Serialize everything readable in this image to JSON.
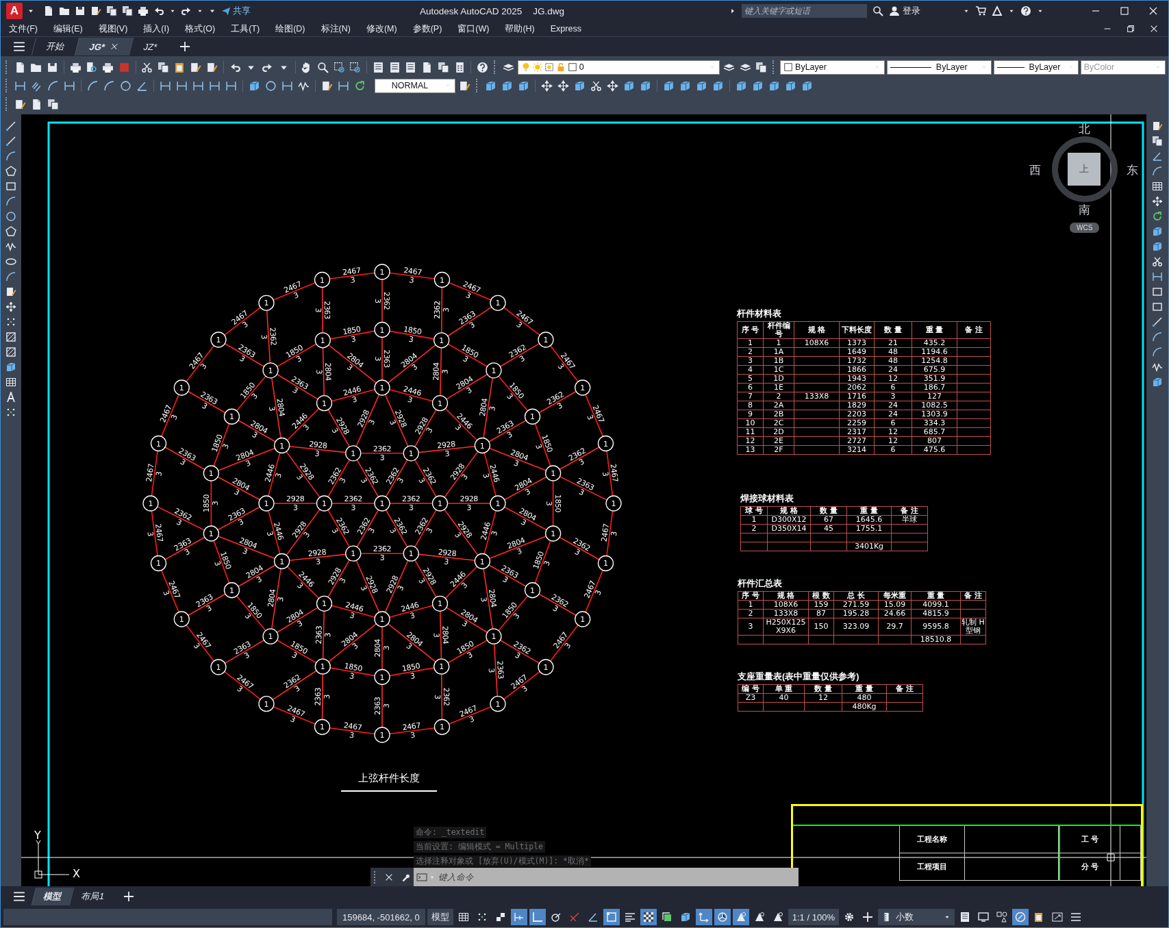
{
  "title_bar": {
    "logo": "A",
    "share": "共享",
    "app_name": "Autodesk AutoCAD 2025",
    "file_name": "JG.dwg",
    "search_placeholder": "键入关键字或短语",
    "user": "登录"
  },
  "menu": [
    "文件(F)",
    "编辑(E)",
    "视图(V)",
    "插入(I)",
    "格式(O)",
    "工具(T)",
    "绘图(D)",
    "标注(N)",
    "修改(M)",
    "参数(P)",
    "窗口(W)",
    "帮助(H)",
    "Express"
  ],
  "doc_tabs": [
    {
      "label": "开始",
      "selected": false,
      "closable": false
    },
    {
      "label": "JG*",
      "selected": true,
      "closable": true
    },
    {
      "label": "JZ*",
      "selected": false,
      "closable": false
    }
  ],
  "properties": {
    "layer": "0",
    "text_style": "NORMAL",
    "color_mode": "ByLayer",
    "linetype": "ByLayer",
    "lineweight": "ByLayer",
    "plot_style": {
      "value": "ByColor",
      "disabled": true
    }
  },
  "drawing": {
    "dome": {
      "node_rings": [
        [
          "1"
        ],
        [
          "1",
          "1",
          "1",
          "1",
          "1",
          "1"
        ],
        [
          "1",
          "1",
          "1",
          "1",
          "1",
          "1",
          "1",
          "1",
          "1",
          "1",
          "1",
          "1"
        ],
        [
          "1",
          "1",
          "1",
          "1",
          "1",
          "1",
          "1",
          "1",
          "1",
          "1",
          "1",
          "1",
          "1",
          "1",
          "1",
          "1",
          "1",
          "1"
        ],
        [
          "1",
          "1",
          "1",
          "1",
          "1",
          "1",
          "1",
          "1",
          "1",
          "1",
          "1",
          "1",
          "1",
          "1",
          "1",
          "1",
          "1",
          "1",
          "1",
          "1",
          "1",
          "1",
          "1",
          "1"
        ]
      ],
      "hoops": [
        [
          {
            "length": "2362",
            "count": "3"
          },
          {
            "length": "2362",
            "count": "3"
          },
          {
            "length": "2362",
            "count": "3"
          },
          {
            "length": "2362",
            "count": "3"
          },
          {
            "length": "2362",
            "count": "3"
          },
          {
            "length": "2362",
            "count": "3"
          }
        ],
        [
          {
            "length": "2446",
            "count": "3"
          },
          {
            "length": "2446",
            "count": "3"
          },
          {
            "length": "2446",
            "count": "3"
          },
          {
            "length": "2446",
            "count": "3"
          },
          {
            "length": "2446",
            "count": "3"
          },
          {
            "length": "2446",
            "count": "3"
          },
          {
            "length": "2446",
            "count": "3"
          },
          {
            "length": "2446",
            "count": "3"
          },
          {
            "length": "2446",
            "count": "3"
          },
          {
            "length": "2446",
            "count": "3"
          },
          {
            "length": "2446",
            "count": "3"
          },
          {
            "length": "2446",
            "count": "3"
          }
        ],
        [
          {
            "length": "1850",
            "count": "3"
          },
          {
            "length": "1850",
            "count": "3"
          },
          {
            "length": "1850",
            "count": "3"
          },
          {
            "length": "1850",
            "count": "3"
          },
          {
            "length": "1850",
            "count": "3"
          },
          {
            "length": "1850",
            "count": "3"
          },
          {
            "length": "1850",
            "count": "3"
          },
          {
            "length": "1850",
            "count": "3"
          },
          {
            "length": "1850",
            "count": "3"
          },
          {
            "length": "1850",
            "count": "3"
          },
          {
            "length": "1850",
            "count": "3"
          },
          {
            "length": "1850",
            "count": "3"
          },
          {
            "length": "1850",
            "count": "3"
          },
          {
            "length": "1850",
            "count": "3"
          },
          {
            "length": "1850",
            "count": "3"
          },
          {
            "length": "1850",
            "count": "3"
          },
          {
            "length": "1850",
            "count": "3"
          },
          {
            "length": "1850",
            "count": "3"
          }
        ],
        [
          {
            "length": "2467",
            "count": "3"
          },
          {
            "length": "2467",
            "count": "3"
          },
          {
            "length": "2467",
            "count": "3"
          },
          {
            "length": "2467",
            "count": "3"
          },
          {
            "length": "2467",
            "count": "3"
          },
          {
            "length": "2467",
            "count": "3"
          },
          {
            "length": "2467",
            "count": "3"
          },
          {
            "length": "2467",
            "count": "3"
          },
          {
            "length": "2467",
            "count": "3"
          },
          {
            "length": "2467",
            "count": "3"
          },
          {
            "length": "2467",
            "count": "3"
          },
          {
            "length": "2467",
            "count": "3"
          },
          {
            "length": "2467",
            "count": "3"
          },
          {
            "length": "2467",
            "count": "3"
          },
          {
            "length": "2467",
            "count": "3"
          },
          {
            "length": "2467",
            "count": "3"
          },
          {
            "length": "2467",
            "count": "3"
          },
          {
            "length": "2467",
            "count": "3"
          },
          {
            "length": "2467",
            "count": "3"
          },
          {
            "length": "2467",
            "count": "3"
          },
          {
            "length": "2467",
            "count": "3"
          },
          {
            "length": "2467",
            "count": "3"
          },
          {
            "length": "2467",
            "count": "3"
          },
          {
            "length": "2467",
            "count": "3"
          }
        ]
      ],
      "spokes": [
        [
          {
            "length": "2362",
            "count": "3"
          },
          {
            "length": "2362",
            "count": "3"
          },
          {
            "length": "2362",
            "count": "3"
          },
          {
            "length": "2362",
            "count": "3"
          },
          {
            "length": "2362",
            "count": "3"
          },
          {
            "length": "2362",
            "count": "3"
          }
        ],
        [
          {
            "length": "2928",
            "count": "3"
          },
          {
            "length": "2928",
            "count": "3"
          },
          {
            "length": "2928",
            "count": "3"
          },
          {
            "length": "2928",
            "count": "3"
          },
          {
            "length": "2928",
            "count": "3"
          },
          {
            "length": "2928",
            "count": "3"
          },
          {
            "length": "2928",
            "count": "3"
          },
          {
            "length": "2928",
            "count": "3"
          },
          {
            "length": "2928",
            "count": "3"
          },
          {
            "length": "2928",
            "count": "3"
          },
          {
            "length": "2928",
            "count": "3"
          },
          {
            "length": "2928",
            "count": "3"
          },
          {
            "length": "2928",
            "count": "3"
          },
          {
            "length": "2928",
            "count": "3"
          },
          {
            "length": "2928",
            "count": "3"
          },
          {
            "length": "2928",
            "count": "3"
          },
          {
            "length": "2928",
            "count": "3"
          },
          {
            "length": "2928",
            "count": "3"
          }
        ],
        [
          {
            "length": "2363",
            "count": "3"
          },
          {
            "length": "2804",
            "count": "3"
          },
          {
            "length": "2804",
            "count": "3"
          },
          {
            "length": "2804",
            "count": "3"
          },
          {
            "length": "2804",
            "count": "3"
          },
          {
            "length": "2363",
            "count": "3"
          },
          {
            "length": "2804",
            "count": "3"
          },
          {
            "length": "2804",
            "count": "3"
          },
          {
            "length": "2804",
            "count": "3"
          },
          {
            "length": "2804",
            "count": "3"
          },
          {
            "length": "2363",
            "count": "3"
          },
          {
            "length": "2804",
            "count": "3"
          },
          {
            "length": "2804",
            "count": "3"
          },
          {
            "length": "2804",
            "count": "3"
          },
          {
            "length": "2804",
            "count": "3"
          },
          {
            "length": "2363",
            "count": "3"
          },
          {
            "length": "2804",
            "count": "3"
          },
          {
            "length": "2804",
            "count": "3"
          },
          {
            "length": "2804",
            "count": "3"
          },
          {
            "length": "2804",
            "count": "3"
          },
          {
            "length": "2363",
            "count": "3"
          },
          {
            "length": "2804",
            "count": "3"
          },
          {
            "length": "2804",
            "count": "3"
          },
          {
            "length": "2804",
            "count": "3"
          },
          {
            "length": "2804",
            "count": "3"
          },
          {
            "length": "2363",
            "count": "3"
          },
          {
            "length": "2804",
            "count": "3"
          },
          {
            "length": "2804",
            "count": "3"
          },
          {
            "length": "2804",
            "count": "3"
          },
          {
            "length": "2804",
            "count": "3"
          }
        ],
        [
          {
            "length": "2362",
            "count": "3"
          },
          {
            "length": "2363",
            "count": "3"
          },
          {
            "length": "2362",
            "count": "3"
          },
          {
            "length": "2363",
            "count": "3"
          },
          {
            "length": "2362",
            "count": "3"
          },
          {
            "length": "2363",
            "count": "3"
          },
          {
            "length": "2362",
            "count": "3"
          },
          {
            "length": "2363",
            "count": "3"
          },
          {
            "length": "2362",
            "count": "3"
          },
          {
            "length": "2363",
            "count": "3"
          },
          {
            "length": "2362",
            "count": "3"
          },
          {
            "length": "2363",
            "count": "3"
          },
          {
            "length": "2362",
            "count": "3"
          },
          {
            "length": "2363",
            "count": "3"
          },
          {
            "length": "2362",
            "count": "3"
          },
          {
            "length": "2363",
            "count": "3"
          },
          {
            "length": "2362",
            "count": "3"
          },
          {
            "length": "2363",
            "count": "3"
          },
          {
            "length": "2362",
            "count": "3"
          },
          {
            "length": "2363",
            "count": "3"
          },
          {
            "length": "2362",
            "count": "3"
          },
          {
            "length": "2363",
            "count": "3"
          },
          {
            "length": "2362",
            "count": "3"
          },
          {
            "length": "2363",
            "count": "3"
          }
        ]
      ]
    },
    "caption": "上弦杆件长度",
    "tables": [
      {
        "title": "杆件材料表",
        "columns": [
          "序 号",
          "杆件编号",
          "规 格",
          "下料长度",
          "数 量",
          "重 量",
          "备 注"
        ],
        "rows": [
          [
            "1",
            "1",
            "108X6",
            "1373",
            "21",
            "435.2",
            null
          ],
          [
            "2",
            "1A",
            null,
            "1649",
            "48",
            "1194.6",
            null
          ],
          [
            "3",
            "1B",
            null,
            "1732",
            "48",
            "1254.8",
            null
          ],
          [
            "4",
            "1C",
            null,
            "1866",
            "24",
            "675.9",
            null
          ],
          [
            "5",
            "1D",
            null,
            "1943",
            "12",
            "351.9",
            null
          ],
          [
            "6",
            "1E",
            null,
            "2062",
            "6",
            "186.7",
            null
          ],
          [
            "7",
            "2",
            "133X8",
            "1716",
            "3",
            "127",
            null
          ],
          [
            "8",
            "2A",
            null,
            "1829",
            "24",
            "1082.5",
            null
          ],
          [
            "9",
            "2B",
            null,
            "2203",
            "24",
            "1303.9",
            null
          ],
          [
            "10",
            "2C",
            null,
            "2259",
            "6",
            "334.3",
            null
          ],
          [
            "11",
            "2D",
            null,
            "2317",
            "12",
            "685.7",
            null
          ],
          [
            "12",
            "2E",
            null,
            "2727",
            "12",
            "807",
            null
          ],
          [
            "13",
            "2F",
            null,
            "3214",
            "6",
            "475.6",
            null
          ]
        ]
      },
      {
        "title": "焊接球材料表",
        "columns": [
          "球 号",
          "规 格",
          "数 量",
          "重 量",
          "备 注"
        ],
        "rows": [
          [
            "1",
            "D300X12",
            "67",
            "1645.6",
            "半球"
          ],
          [
            "2",
            "D350X14",
            "45",
            "1755.1",
            null
          ],
          [
            null,
            null,
            null,
            null,
            null
          ],
          [
            null,
            null,
            null,
            "3401Kg",
            null
          ]
        ]
      },
      {
        "title": "杆件汇总表",
        "columns": [
          "序 号",
          "规 格",
          "根 数",
          "总 长",
          "每米重",
          "重 量",
          "备 注"
        ],
        "rows": [
          [
            "1",
            "108X6",
            "159",
            "271.59",
            "15.09",
            "4099.1",
            null
          ],
          [
            "2",
            "133X8",
            "87",
            "195.28",
            "24.66",
            "4815.9",
            null
          ],
          [
            "3",
            "H250X125 X9X6",
            "150",
            "323.09",
            "29.7",
            "9595.8",
            "轧制 H型钢"
          ],
          [
            null,
            null,
            null,
            null,
            null,
            "18510.8",
            null
          ]
        ]
      },
      {
        "title": "支座重量表(表中重量仅供参考)",
        "columns": [
          "编 号",
          "单 重",
          "数 量",
          "重 量",
          "备 注"
        ],
        "rows": [
          [
            "Z3",
            "40",
            "12",
            "480",
            null
          ],
          [
            null,
            null,
            null,
            "480Kg",
            null
          ]
        ]
      }
    ],
    "title_block": {
      "project_name_label": "工程名称",
      "job_no_label": "工 号",
      "project_item_label": "工程项目",
      "sub_no_label": "分 号"
    },
    "viewcube": {
      "north": "北",
      "south": "南",
      "west": "西",
      "east": "东",
      "top": "上",
      "wcs": "WCS"
    },
    "ucs": {
      "x_label": "X",
      "y_label": "Y"
    }
  },
  "command_line": {
    "history": [
      "命令: _textedit",
      "当前设置: 编辑模式 = Multiple",
      "选择注释对象或 [放弃(U)/模式(M)]: *取消*"
    ],
    "placeholder": "键入命令"
  },
  "layout_tabs": [
    {
      "label": "模型",
      "selected": true
    },
    {
      "label": "布局1",
      "selected": false
    }
  ],
  "status_bar": {
    "coordinates": "159684, -501662, 0",
    "space": "模型",
    "toggles": [
      {
        "kind": "grid",
        "on": false
      },
      {
        "kind": "dots",
        "on": false
      },
      {
        "kind": "corner",
        "on": false
      },
      {
        "kind": "infer",
        "on": true
      },
      {
        "kind": "ortho",
        "on": true
      },
      {
        "kind": "polar",
        "on": false
      },
      {
        "kind": "track",
        "on": false
      },
      {
        "kind": "angle",
        "on": false
      },
      {
        "kind": "osnap",
        "on": true
      },
      {
        "kind": "lines",
        "on": false
      },
      {
        "kind": "checker",
        "on": true
      },
      {
        "kind": "cycle",
        "on": false
      },
      {
        "kind": "box",
        "on": false
      },
      {
        "kind": "axes",
        "on": true
      },
      {
        "kind": "gizmo",
        "on": true
      },
      {
        "kind": "annot",
        "on": true
      },
      {
        "kind": "annot",
        "on": false
      },
      {
        "kind": "annot",
        "on": false
      }
    ],
    "scale": "1:1 / 100%",
    "units": "小数"
  }
}
